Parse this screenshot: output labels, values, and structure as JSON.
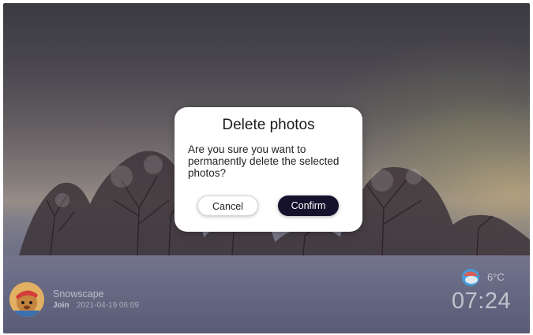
{
  "dialog": {
    "title": "Delete photos",
    "message": "Are you sure you want to permanently delete the selected photos?",
    "cancel_label": "Cancel",
    "confirm_label": "Confirm"
  },
  "album": {
    "name": "Snowscape",
    "join_label": "Join",
    "date": "2021-04-19 06:09"
  },
  "status": {
    "weather_icon": "partly-cloudy-icon",
    "temperature": "6°C",
    "time": "07:24"
  },
  "colors": {
    "confirm_button": "#16122e",
    "dialog_background": "#ffffff"
  }
}
